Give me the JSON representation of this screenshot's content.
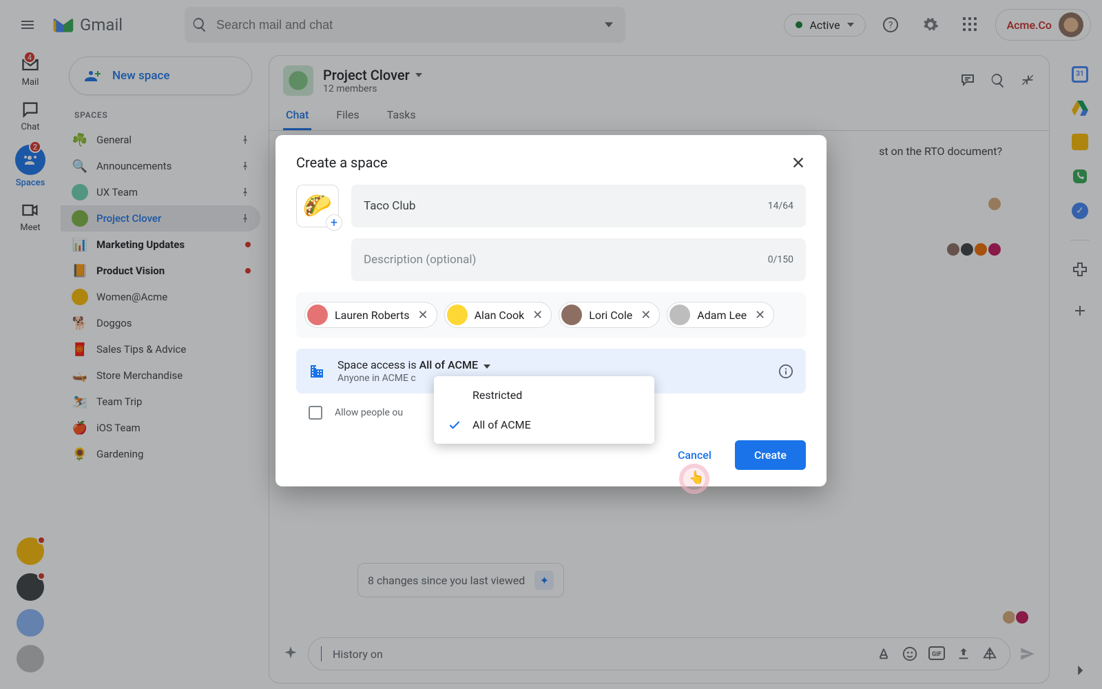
{
  "header": {
    "app_name": "Gmail",
    "search_placeholder": "Search mail and chat",
    "status_label": "Active",
    "org_name": "Acme.Co"
  },
  "rail": {
    "items": [
      {
        "label": "Mail",
        "badge": "4"
      },
      {
        "label": "Chat"
      },
      {
        "label": "Spaces",
        "badge": "2",
        "active": true
      },
      {
        "label": "Meet"
      }
    ]
  },
  "panel2": {
    "new_space": "New space",
    "section": "SPACES",
    "items": [
      {
        "emoji": "☘️",
        "label": "General",
        "pinned": true
      },
      {
        "emoji": "🔍",
        "label": "Announcements",
        "pinned": true
      },
      {
        "emoji": "",
        "avatarBg": "#6dd5b3",
        "label": "UX Team",
        "pinned": true
      },
      {
        "emoji": "",
        "avatarBg": "#7cb342",
        "label": "Project Clover",
        "pinned": true,
        "active": true
      },
      {
        "emoji": "📊",
        "avatarBg": "#fbbc04",
        "label": "Marketing Updates",
        "bold": true,
        "unread": true
      },
      {
        "emoji": "📙",
        "label": "Product Vision",
        "bold": true,
        "unread": true
      },
      {
        "emoji": "",
        "avatarBg": "#fbbc04",
        "label": "Women@Acme"
      },
      {
        "emoji": "🐕",
        "label": "Doggos"
      },
      {
        "emoji": "🧧",
        "label": "Sales Tips & Advice"
      },
      {
        "emoji": "🛶",
        "label": "Store Merchandise"
      },
      {
        "emoji": "⛷️",
        "label": "Team Trip"
      },
      {
        "emoji": "🍎",
        "label": "iOS Team"
      },
      {
        "emoji": "🌻",
        "label": "Gardening"
      }
    ]
  },
  "main": {
    "space_title": "Project Clover",
    "space_sub": "12 members",
    "tabs": [
      "Chat",
      "Files",
      "Tasks"
    ],
    "message_fragment": "st on the RTO document?",
    "changes_text": "8 changes since you last viewed",
    "composer_placeholder": "History on"
  },
  "dialog": {
    "title": "Create a space",
    "emoji": "🌮",
    "name_value": "Taco Club",
    "name_counter": "14/64",
    "desc_placeholder": "Description (optional)",
    "desc_counter": "0/150",
    "people": [
      {
        "name": "Lauren Roberts",
        "bg": "#e57373"
      },
      {
        "name": "Alan Cook",
        "bg": "#fdd835"
      },
      {
        "name": "Lori Cole",
        "bg": "#8d6e63"
      },
      {
        "name": "Adam Lee",
        "bg": "#bdbdbd"
      }
    ],
    "access_prefix": "Space access is ",
    "access_value": "All of ACME",
    "access_sub": "Anyone in ACME c",
    "dropdown": [
      {
        "label": "Restricted"
      },
      {
        "label": "All of ACME",
        "selected": true
      }
    ],
    "outside_label": "Allow people ou",
    "cancel": "Cancel",
    "create": "Create"
  }
}
